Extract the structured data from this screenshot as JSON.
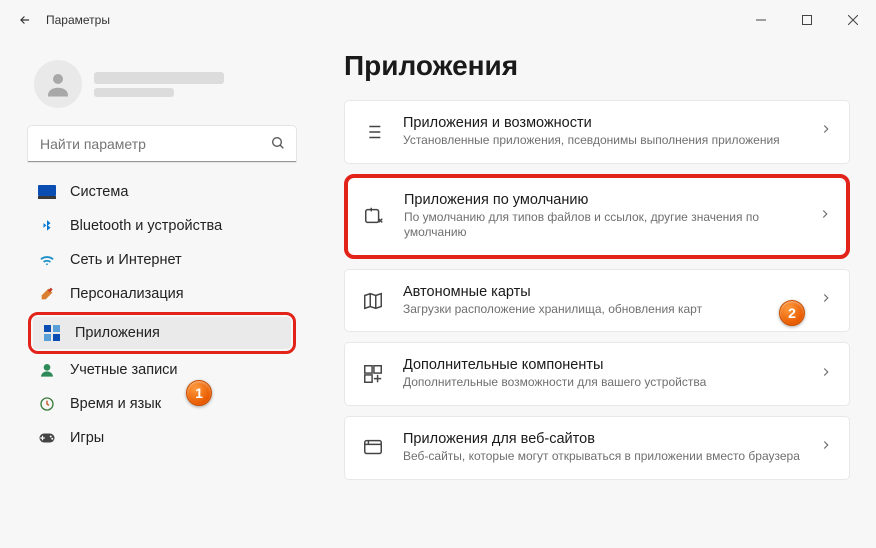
{
  "titlebar": {
    "title": "Параметры"
  },
  "search": {
    "placeholder": "Найти параметр"
  },
  "sidebar": {
    "items": [
      {
        "label": "Система"
      },
      {
        "label": "Bluetooth и устройства"
      },
      {
        "label": "Сеть и Интернет"
      },
      {
        "label": "Персонализация"
      },
      {
        "label": "Приложения"
      },
      {
        "label": "Учетные записи"
      },
      {
        "label": "Время и язык"
      },
      {
        "label": "Игры"
      }
    ]
  },
  "page": {
    "title": "Приложения"
  },
  "cards": [
    {
      "title": "Приложения и возможности",
      "desc": "Установленные приложения, псевдонимы выполнения приложения"
    },
    {
      "title": "Приложения по умолчанию",
      "desc": "По умолчанию для типов файлов и ссылок, другие значения по умолчанию"
    },
    {
      "title": "Автономные карты",
      "desc": "Загрузки расположение хранилища, обновления карт"
    },
    {
      "title": "Дополнительные компоненты",
      "desc": "Дополнительные возможности для вашего устройства"
    },
    {
      "title": "Приложения для веб-сайтов",
      "desc": "Веб-сайты, которые могут открываться в приложении вместо браузера"
    }
  ],
  "annotations": {
    "badge1": "1",
    "badge2": "2"
  }
}
